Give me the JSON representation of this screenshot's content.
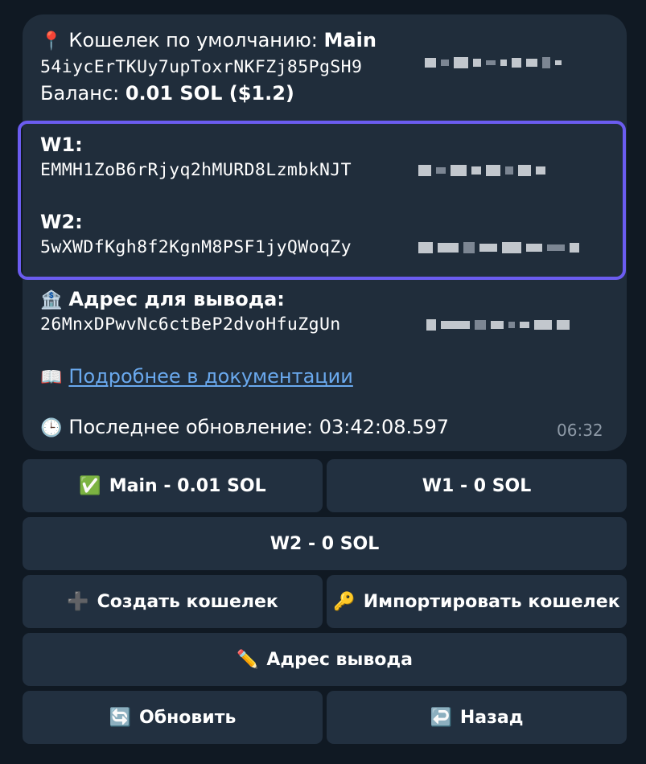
{
  "message": {
    "default_wallet_prefix": "Кошелек по умолчанию: ",
    "default_wallet_name": "Main",
    "default_wallet_address": "54iycErTKUy7upToxrNKFZj85PgSH9",
    "balance_label": "Баланс: ",
    "balance_value": "0.01 SOL ($1.2)",
    "w1_label": "W1:",
    "w1_address": "EMMH1ZoB6rRjyq2hMURD8LzmbkNJT",
    "w2_label": "W2:",
    "w2_address": "5wXWDfKgh8f2KgnM8PSF1jyQWoqZy",
    "withdraw_label": "Адрес для вывода:",
    "withdraw_address": "26MnxDPwvNc6ctBeP2dvoHfuZgUn",
    "docs_link": "Подробнее в документации",
    "last_update": "Последнее обновление: 03:42:08.597",
    "time": "06:32"
  },
  "icons": {
    "pin": "📍",
    "bank": "🏦",
    "book": "📖",
    "clock": "🕒"
  },
  "buttons": {
    "main": {
      "icon": "✅",
      "label": "Main - 0.01 SOL"
    },
    "w1": {
      "label": "W1 - 0 SOL"
    },
    "w2": {
      "label": "W2 - 0 SOL"
    },
    "create": {
      "icon": "➕",
      "label": "Создать кошелек"
    },
    "import": {
      "icon": "🔑",
      "label": "Импортировать кошелек"
    },
    "withdraw": {
      "icon": "✏️",
      "label": "Адрес вывода"
    },
    "refresh": {
      "icon": "🔄",
      "label": "Обновить"
    },
    "back": {
      "icon": "↩️",
      "label": "Назад"
    }
  },
  "colors": {
    "background": "#101923",
    "bubble": "#202d3b",
    "button": "#223040",
    "highlight_border": "#6b5cf0",
    "link": "#6aa9ee"
  }
}
